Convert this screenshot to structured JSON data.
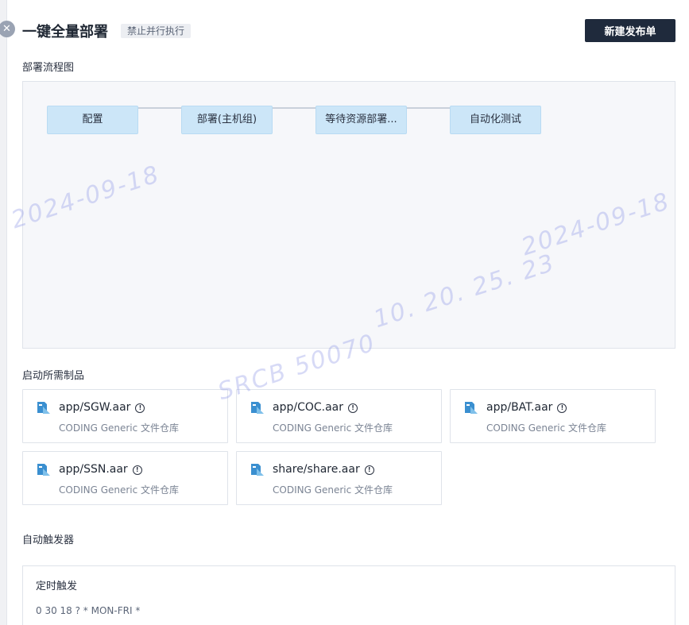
{
  "header": {
    "title": "一键全量部署",
    "tag": "禁止并行执行",
    "new_release_button": "新建发布单"
  },
  "sections": {
    "flow": "部署流程图",
    "artifacts": "启动所需制品",
    "triggers": "自动触发器"
  },
  "flow_nodes": [
    {
      "label": "配置"
    },
    {
      "label": "部署(主机组)"
    },
    {
      "label": "等待资源部署..."
    },
    {
      "label": "自动化测试"
    }
  ],
  "artifacts": [
    {
      "name": "app/SGW.aar",
      "repo": "CODING Generic 文件仓库"
    },
    {
      "name": "app/COC.aar",
      "repo": "CODING Generic 文件仓库"
    },
    {
      "name": "app/BAT.aar",
      "repo": "CODING Generic 文件仓库"
    },
    {
      "name": "app/SSN.aar",
      "repo": "CODING Generic 文件仓库"
    },
    {
      "name": "share/share.aar",
      "repo": "CODING Generic 文件仓库"
    }
  ],
  "trigger": {
    "title": "定时触发",
    "cron": "0 30 18 ? * MON-FRI *"
  },
  "watermark": {
    "date1": "2024-09-18",
    "date2": "2024-09-18",
    "ip": "10. 20. 25. 23",
    "user": "SRCB  50070"
  },
  "icons": {
    "close": "close-icon",
    "file": "file-icon",
    "info": "info-icon"
  },
  "colors": {
    "primary_button": "#1f2a3c",
    "flow_node": "#cce6f8",
    "file_icon": "#3a8fd0",
    "canvas_bg": "#f6f7fa"
  }
}
